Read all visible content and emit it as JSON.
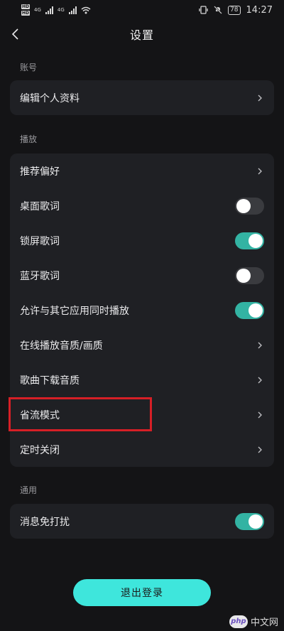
{
  "status_bar": {
    "hd_top": "HD",
    "hd_bottom": "HD",
    "net_1": "4G",
    "net_2": "4G",
    "battery": "78",
    "time": "14:27"
  },
  "header": {
    "title": "设置"
  },
  "sections": {
    "account": {
      "label": "账号",
      "items": [
        {
          "label": "编辑个人资料",
          "type": "chevron"
        }
      ]
    },
    "playback": {
      "label": "播放",
      "items": [
        {
          "label": "推荐偏好",
          "type": "chevron"
        },
        {
          "label": "桌面歌词",
          "type": "toggle",
          "on": false
        },
        {
          "label": "锁屏歌词",
          "type": "toggle",
          "on": true
        },
        {
          "label": "蓝牙歌词",
          "type": "toggle",
          "on": false
        },
        {
          "label": "允许与其它应用同时播放",
          "type": "toggle",
          "on": true
        },
        {
          "label": "在线播放音质/画质",
          "type": "chevron"
        },
        {
          "label": "歌曲下载音质",
          "type": "chevron"
        },
        {
          "label": "省流模式",
          "type": "chevron"
        },
        {
          "label": "定时关闭",
          "type": "chevron"
        }
      ]
    },
    "general": {
      "label": "通用",
      "items": [
        {
          "label": "消息免打扰",
          "type": "toggle",
          "on": true
        }
      ]
    }
  },
  "logout": {
    "label": "退出登录"
  },
  "watermark": {
    "badge": "php",
    "text": "中文网"
  },
  "colors": {
    "background": "#141416",
    "card": "#1f2024",
    "toggle_on": "#33b3a3",
    "toggle_off": "#3a3b3f",
    "logout_button": "#3ee6dc",
    "highlight_box": "#d61f26"
  }
}
